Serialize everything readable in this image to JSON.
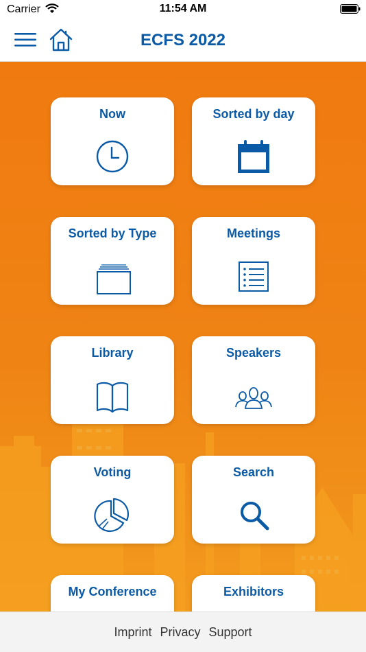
{
  "status_bar": {
    "carrier": "Carrier",
    "time": "11:54 AM"
  },
  "nav": {
    "title": "ECFS 2022",
    "menu_icon": "hamburger-icon",
    "home_icon": "home-icon"
  },
  "colors": {
    "brand_blue": "#0b5aa6",
    "background_orange": "#f07a10"
  },
  "tiles": [
    {
      "label": "Now",
      "icon": "clock-icon"
    },
    {
      "label": "Sorted by day",
      "icon": "calendar-icon"
    },
    {
      "label": "Sorted by Type",
      "icon": "folder-stack-icon"
    },
    {
      "label": "Meetings",
      "icon": "list-icon"
    },
    {
      "label": "Library",
      "icon": "book-icon"
    },
    {
      "label": "Speakers",
      "icon": "people-icon"
    },
    {
      "label": "Voting",
      "icon": "pie-chart-icon"
    },
    {
      "label": "Search",
      "icon": "search-icon"
    },
    {
      "label": "My Conference",
      "icon": ""
    },
    {
      "label": "Exhibitors",
      "icon": ""
    }
  ],
  "footer": {
    "links": [
      "Imprint",
      "Privacy",
      "Support"
    ]
  }
}
